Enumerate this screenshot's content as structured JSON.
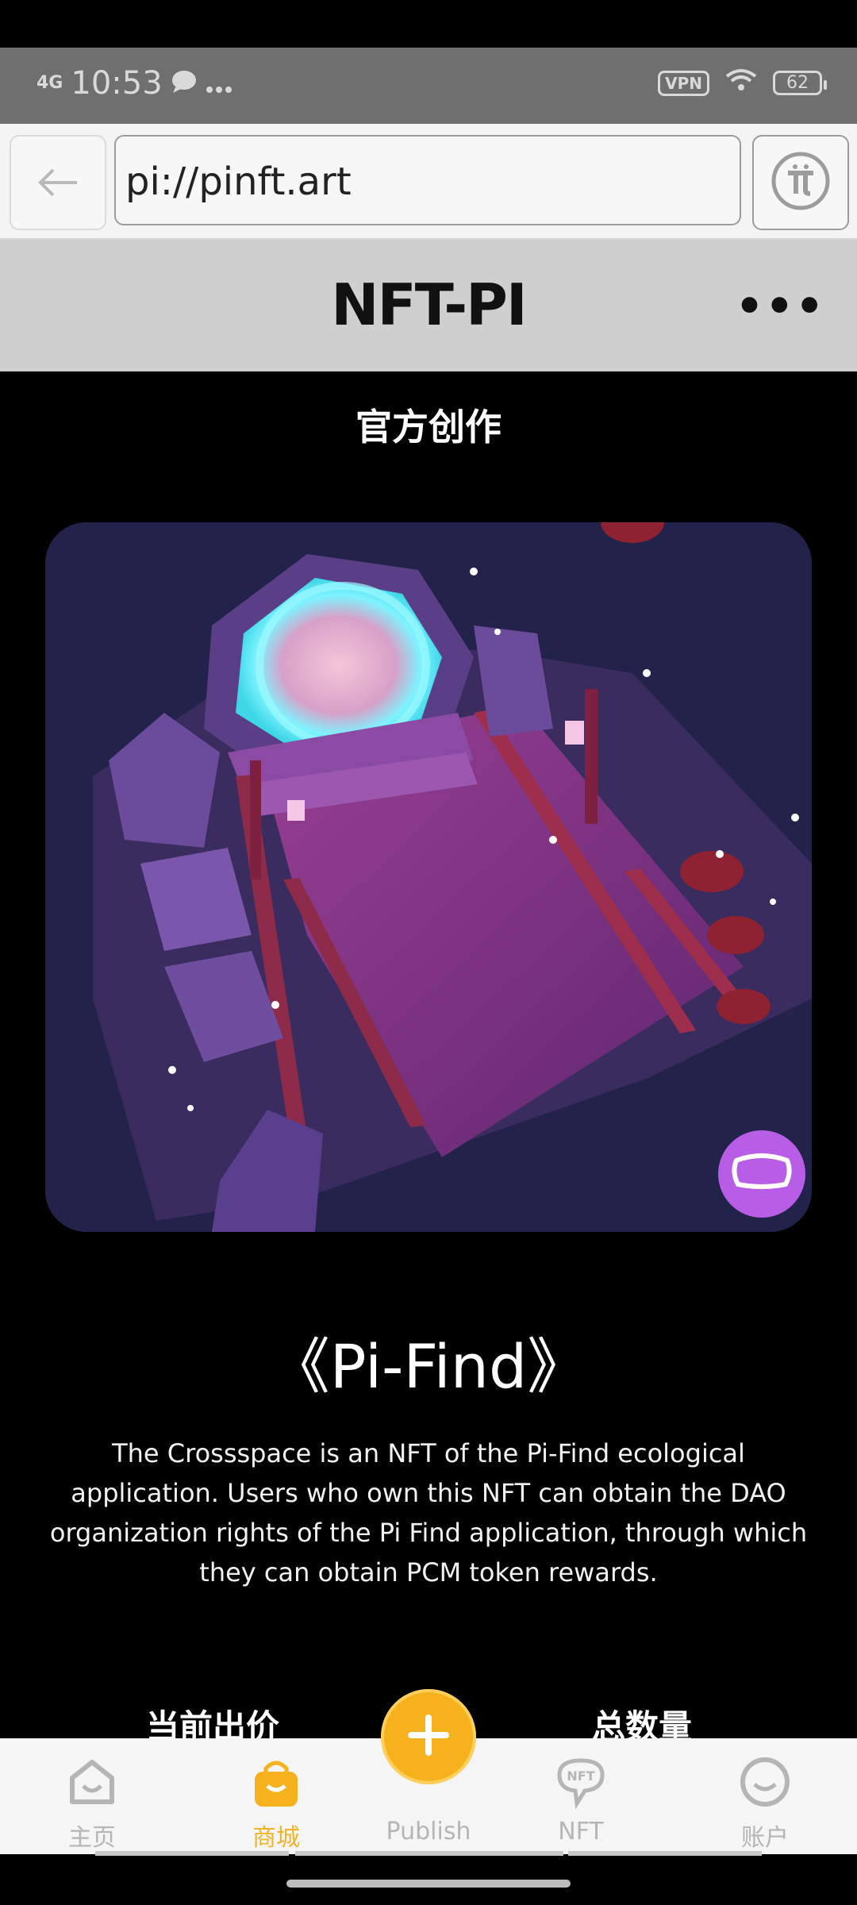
{
  "status_bar": {
    "network": "4G",
    "time": "10:53",
    "vpn": "VPN",
    "battery": "62",
    "icons": [
      "chat-bubble-icon",
      "more-dots-icon",
      "wifi-icon",
      "battery-icon"
    ]
  },
  "browser": {
    "url": "pi://pinft.art",
    "back_icon": "back-arrow-icon",
    "pi_icon": "pi-logo-icon"
  },
  "header": {
    "title": "NFT-PI",
    "more_label": "•••"
  },
  "section_title": "官方创作",
  "nft": {
    "title": "《Pi-Find》",
    "description": "The Crossspace is an NFT of the Pi-Find ecological application. Users who own this NFT can obtain the DAO organization rights of the Pi Find application, through which they can obtain PCM token rewards.",
    "vr_icon": "vr-headset-icon"
  },
  "stats": {
    "current_bid_label": "当前出价",
    "total_label": "总数量"
  },
  "tabs": [
    {
      "label": "主页",
      "icon": "home-icon",
      "active": false
    },
    {
      "label": "商城",
      "icon": "shopping-bag-icon",
      "active": true
    },
    {
      "label": "Publish",
      "icon": "plus-icon",
      "active": false
    },
    {
      "label": "NFT",
      "icon": "nft-icon",
      "active": false
    },
    {
      "label": "账户",
      "icon": "account-icon",
      "active": false
    }
  ],
  "colors": {
    "accent": "#f6b21d",
    "vr_button": "#b85ee6",
    "background": "#000000"
  }
}
